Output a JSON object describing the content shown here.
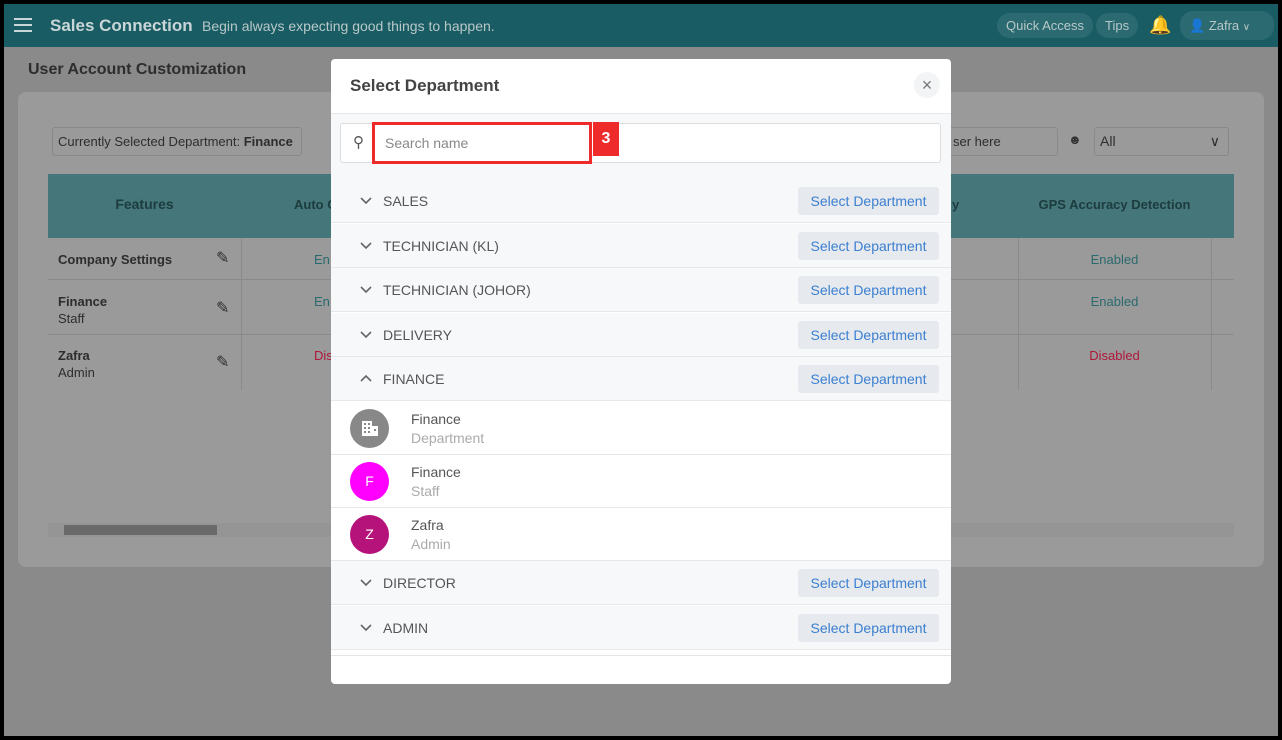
{
  "header": {
    "app_title": "Sales Connection",
    "tagline": "Begin always expecting good things to happen.",
    "quick_access": "Quick Access",
    "tips": "Tips",
    "user": "Zafra"
  },
  "page": {
    "title": "User Account Customization",
    "current_dept_label": "Currently Selected Department:",
    "current_dept_value": "Finance",
    "search_user_placeholder": "ser here",
    "filter_value": "All"
  },
  "table": {
    "headers": [
      "Features",
      "Auto C",
      "y",
      "GPS Accuracy Detection"
    ],
    "rows": [
      {
        "name": "Company Settings",
        "role": "",
        "col2": "En",
        "gps": "Enabled"
      },
      {
        "name": "Finance",
        "role": "Staff",
        "col2": "En",
        "gps": "Enabled"
      },
      {
        "name": "Zafra",
        "role": "Admin",
        "col2": "Dis",
        "gps": "Disabled"
      }
    ]
  },
  "modal": {
    "title": "Select Department",
    "search_placeholder": "Search name",
    "annotation": "3",
    "select_label": "Select Department",
    "departments": [
      "SALES",
      "TECHNICIAN (KL)",
      "TECHNICIAN (JOHOR)",
      "DELIVERY",
      "FINANCE",
      "DIRECTOR",
      "ADMIN"
    ],
    "expanded": "FINANCE",
    "members": [
      {
        "name": "Finance",
        "role": "Department",
        "avatar": "building-icon",
        "color": "#888888"
      },
      {
        "name": "Finance",
        "role": "Staff",
        "initial": "F",
        "color": "#ff00ff"
      },
      {
        "name": "Zafra",
        "role": "Admin",
        "initial": "Z",
        "color": "#b5127a"
      }
    ]
  },
  "colors": {
    "header": "#1a5c63",
    "enabled": "#2a6a6e",
    "disabled": "#b0163a",
    "link": "#3b7fd1",
    "annotation": "#ee2a2a"
  }
}
